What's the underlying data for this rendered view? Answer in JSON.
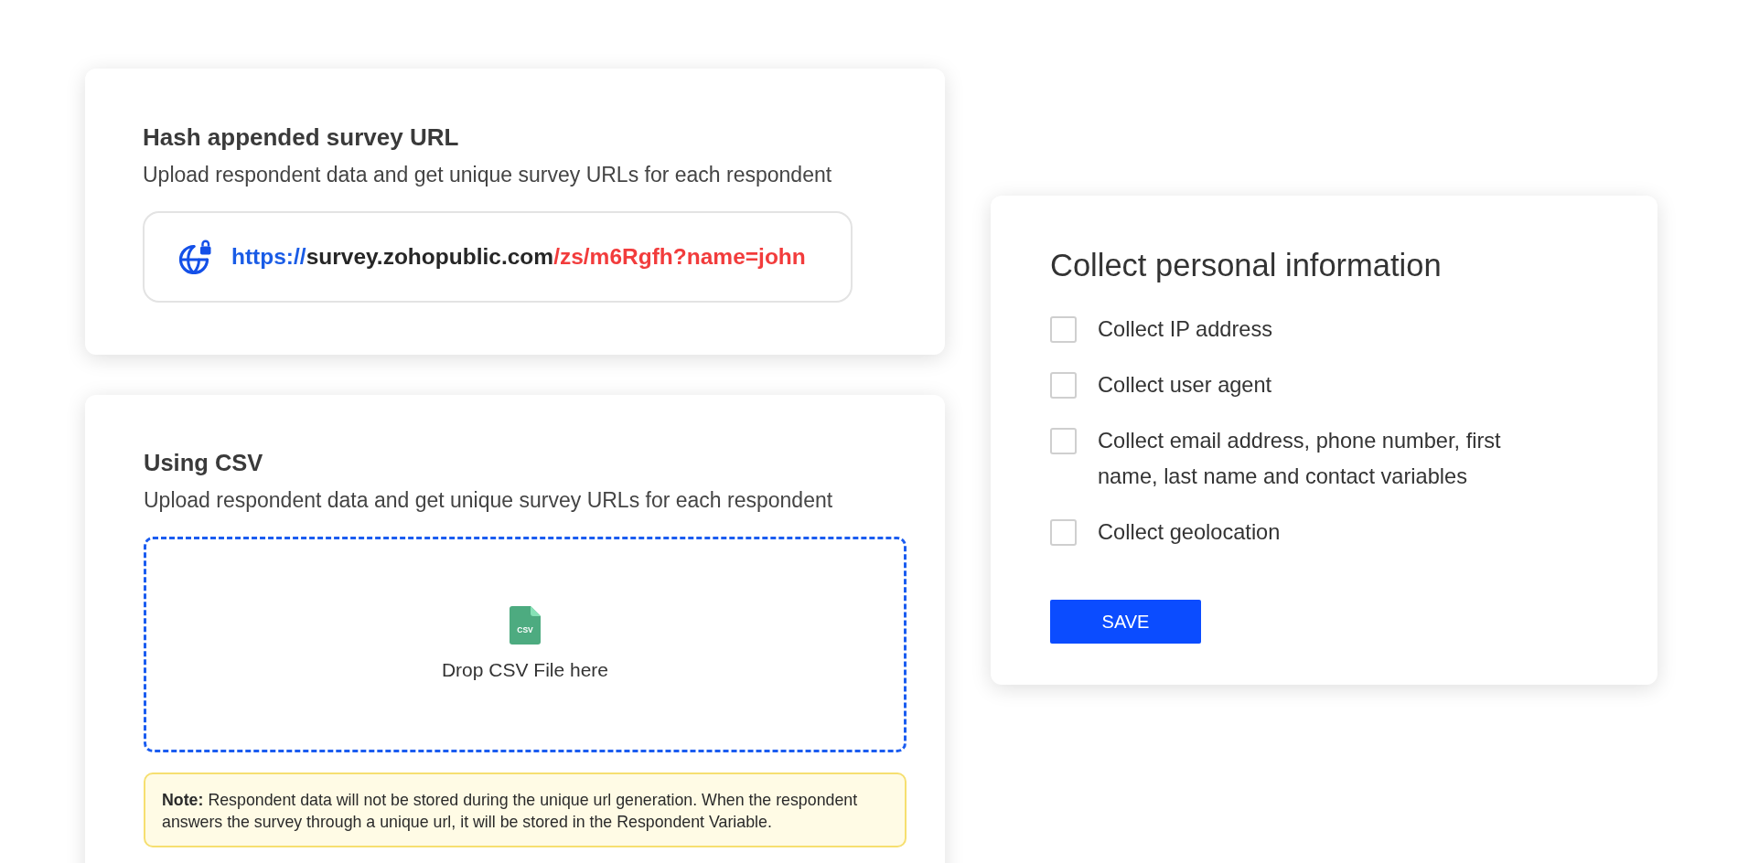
{
  "url_card": {
    "title": "Hash appended survey URL",
    "description": "Upload respondent data and get unique survey URLs for each respondent",
    "url": {
      "scheme": "https://",
      "host": "survey.zohopublic.com",
      "path": "/zs/m6Rgfh?name=john"
    }
  },
  "csv_card": {
    "title": "Using CSV",
    "description": "Upload respondent data and get unique survey URLs for each respondent",
    "drop_zone": {
      "file_icon_text": "CSV",
      "label": "Drop CSV File here"
    },
    "note": "**Note:** Respondent data will not be stored during the unique url generation. When the respondent answers the survey through a unique url, it will be stored in the Respondent Variable."
  },
  "personal_info_card": {
    "title": "Collect personal information",
    "options": [
      {
        "label": "Collect IP address",
        "checked": false
      },
      {
        "label": "Collect user agent",
        "checked": false
      },
      {
        "label": "Collect email address, phone number, first name, last name and contact variables",
        "checked": false
      },
      {
        "label": "Collect geolocation",
        "checked": false
      }
    ],
    "save_button": "SAVE"
  }
}
